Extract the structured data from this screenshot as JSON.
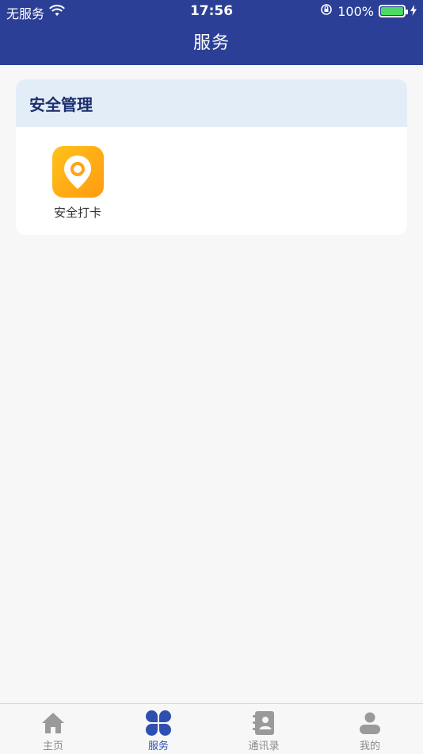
{
  "status_bar": {
    "carrier": "无服务",
    "time": "17:56",
    "battery": "100%"
  },
  "header": {
    "title": "服务"
  },
  "section": {
    "title": "安全管理",
    "apps": [
      {
        "label": "安全打卡",
        "icon": "location-pin-icon"
      }
    ]
  },
  "tabs": [
    {
      "label": "主页",
      "icon": "home-icon",
      "active": false
    },
    {
      "label": "服务",
      "icon": "clover-icon",
      "active": true
    },
    {
      "label": "通讯录",
      "icon": "contacts-book-icon",
      "active": false
    },
    {
      "label": "我的",
      "icon": "person-icon",
      "active": false
    }
  ],
  "colors": {
    "header_bg": "#2b3f96",
    "active_tab": "#2e4fb0",
    "inactive_tab": "#8a8a8a",
    "card_header_bg": "#e3edf8"
  }
}
